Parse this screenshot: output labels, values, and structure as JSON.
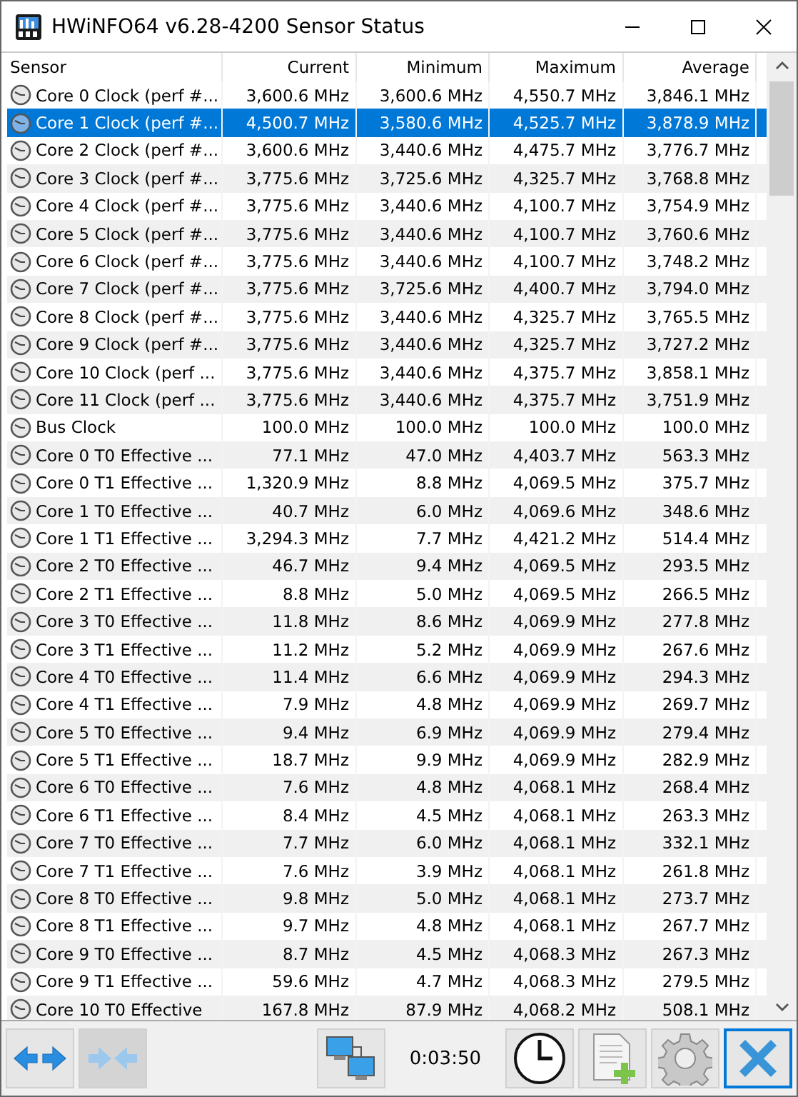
{
  "window": {
    "title": "HWiNFO64 v6.28-4200 Sensor Status"
  },
  "table": {
    "columns": [
      "Sensor",
      "Current",
      "Minimum",
      "Maximum",
      "Average"
    ],
    "rows": [
      {
        "sensor": "Core 0 Clock (perf #...",
        "current": "3,600.6 MHz",
        "minimum": "3,600.6 MHz",
        "maximum": "4,550.7 MHz",
        "average": "3,846.1 MHz",
        "selected": false
      },
      {
        "sensor": "Core 1 Clock (perf #...",
        "current": "4,500.7 MHz",
        "minimum": "3,580.6 MHz",
        "maximum": "4,525.7 MHz",
        "average": "3,878.9 MHz",
        "selected": true
      },
      {
        "sensor": "Core 2 Clock (perf #...",
        "current": "3,600.6 MHz",
        "minimum": "3,440.6 MHz",
        "maximum": "4,475.7 MHz",
        "average": "3,776.7 MHz",
        "selected": false
      },
      {
        "sensor": "Core 3 Clock (perf #...",
        "current": "3,775.6 MHz",
        "minimum": "3,725.6 MHz",
        "maximum": "4,325.7 MHz",
        "average": "3,768.8 MHz",
        "selected": false
      },
      {
        "sensor": "Core 4 Clock (perf #...",
        "current": "3,775.6 MHz",
        "minimum": "3,440.6 MHz",
        "maximum": "4,100.7 MHz",
        "average": "3,754.9 MHz",
        "selected": false
      },
      {
        "sensor": "Core 5 Clock (perf #...",
        "current": "3,775.6 MHz",
        "minimum": "3,440.6 MHz",
        "maximum": "4,100.7 MHz",
        "average": "3,760.6 MHz",
        "selected": false
      },
      {
        "sensor": "Core 6 Clock (perf #...",
        "current": "3,775.6 MHz",
        "minimum": "3,440.6 MHz",
        "maximum": "4,100.7 MHz",
        "average": "3,748.2 MHz",
        "selected": false
      },
      {
        "sensor": "Core 7 Clock (perf #...",
        "current": "3,775.6 MHz",
        "minimum": "3,725.6 MHz",
        "maximum": "4,400.7 MHz",
        "average": "3,794.0 MHz",
        "selected": false
      },
      {
        "sensor": "Core 8 Clock (perf #...",
        "current": "3,775.6 MHz",
        "minimum": "3,440.6 MHz",
        "maximum": "4,325.7 MHz",
        "average": "3,765.5 MHz",
        "selected": false
      },
      {
        "sensor": "Core 9 Clock (perf #...",
        "current": "3,775.6 MHz",
        "minimum": "3,440.6 MHz",
        "maximum": "4,325.7 MHz",
        "average": "3,727.2 MHz",
        "selected": false
      },
      {
        "sensor": "Core 10 Clock (perf ...",
        "current": "3,775.6 MHz",
        "minimum": "3,440.6 MHz",
        "maximum": "4,375.7 MHz",
        "average": "3,858.1 MHz",
        "selected": false
      },
      {
        "sensor": "Core 11 Clock (perf ...",
        "current": "3,775.6 MHz",
        "minimum": "3,440.6 MHz",
        "maximum": "4,375.7 MHz",
        "average": "3,751.9 MHz",
        "selected": false
      },
      {
        "sensor": "Bus Clock",
        "current": "100.0 MHz",
        "minimum": "100.0 MHz",
        "maximum": "100.0 MHz",
        "average": "100.0 MHz",
        "selected": false
      },
      {
        "sensor": "Core 0 T0 Effective ...",
        "current": "77.1 MHz",
        "minimum": "47.0 MHz",
        "maximum": "4,403.7 MHz",
        "average": "563.3 MHz",
        "selected": false
      },
      {
        "sensor": "Core 0 T1 Effective ...",
        "current": "1,320.9 MHz",
        "minimum": "8.8 MHz",
        "maximum": "4,069.5 MHz",
        "average": "375.7 MHz",
        "selected": false
      },
      {
        "sensor": "Core 1 T0 Effective ...",
        "current": "40.7 MHz",
        "minimum": "6.0 MHz",
        "maximum": "4,069.6 MHz",
        "average": "348.6 MHz",
        "selected": false
      },
      {
        "sensor": "Core 1 T1 Effective ...",
        "current": "3,294.3 MHz",
        "minimum": "7.7 MHz",
        "maximum": "4,421.2 MHz",
        "average": "514.4 MHz",
        "selected": false
      },
      {
        "sensor": "Core 2 T0 Effective ...",
        "current": "46.7 MHz",
        "minimum": "9.4 MHz",
        "maximum": "4,069.5 MHz",
        "average": "293.5 MHz",
        "selected": false
      },
      {
        "sensor": "Core 2 T1 Effective ...",
        "current": "8.8 MHz",
        "minimum": "5.0 MHz",
        "maximum": "4,069.5 MHz",
        "average": "266.5 MHz",
        "selected": false
      },
      {
        "sensor": "Core 3 T0 Effective ...",
        "current": "11.8 MHz",
        "minimum": "8.6 MHz",
        "maximum": "4,069.9 MHz",
        "average": "277.8 MHz",
        "selected": false
      },
      {
        "sensor": "Core 3 T1 Effective ...",
        "current": "11.2 MHz",
        "minimum": "5.2 MHz",
        "maximum": "4,069.9 MHz",
        "average": "267.6 MHz",
        "selected": false
      },
      {
        "sensor": "Core 4 T0 Effective ...",
        "current": "11.4 MHz",
        "minimum": "6.6 MHz",
        "maximum": "4,069.9 MHz",
        "average": "294.3 MHz",
        "selected": false
      },
      {
        "sensor": "Core 4 T1 Effective ...",
        "current": "7.9 MHz",
        "minimum": "4.8 MHz",
        "maximum": "4,069.9 MHz",
        "average": "269.7 MHz",
        "selected": false
      },
      {
        "sensor": "Core 5 T0 Effective ...",
        "current": "9.4 MHz",
        "minimum": "6.9 MHz",
        "maximum": "4,069.9 MHz",
        "average": "279.4 MHz",
        "selected": false
      },
      {
        "sensor": "Core 5 T1 Effective ...",
        "current": "18.7 MHz",
        "minimum": "9.9 MHz",
        "maximum": "4,069.9 MHz",
        "average": "282.9 MHz",
        "selected": false
      },
      {
        "sensor": "Core 6 T0 Effective ...",
        "current": "7.6 MHz",
        "minimum": "4.8 MHz",
        "maximum": "4,068.1 MHz",
        "average": "268.4 MHz",
        "selected": false
      },
      {
        "sensor": "Core 6 T1 Effective ...",
        "current": "8.4 MHz",
        "minimum": "4.5 MHz",
        "maximum": "4,068.1 MHz",
        "average": "263.3 MHz",
        "selected": false
      },
      {
        "sensor": "Core 7 T0 Effective ...",
        "current": "7.7 MHz",
        "minimum": "6.0 MHz",
        "maximum": "4,068.1 MHz",
        "average": "332.1 MHz",
        "selected": false
      },
      {
        "sensor": "Core 7 T1 Effective ...",
        "current": "7.6 MHz",
        "minimum": "3.9 MHz",
        "maximum": "4,068.1 MHz",
        "average": "261.8 MHz",
        "selected": false
      },
      {
        "sensor": "Core 8 T0 Effective ...",
        "current": "9.8 MHz",
        "minimum": "5.0 MHz",
        "maximum": "4,068.1 MHz",
        "average": "273.7 MHz",
        "selected": false
      },
      {
        "sensor": "Core 8 T1 Effective ...",
        "current": "9.7 MHz",
        "minimum": "4.8 MHz",
        "maximum": "4,068.1 MHz",
        "average": "267.7 MHz",
        "selected": false
      },
      {
        "sensor": "Core 9 T0 Effective ...",
        "current": "8.7 MHz",
        "minimum": "4.5 MHz",
        "maximum": "4,068.3 MHz",
        "average": "267.3 MHz",
        "selected": false
      },
      {
        "sensor": "Core 9 T1 Effective ...",
        "current": "59.6 MHz",
        "minimum": "4.7 MHz",
        "maximum": "4,068.3 MHz",
        "average": "279.5 MHz",
        "selected": false
      },
      {
        "sensor": "Core 10 T0 Effective",
        "current": "167.8 MHz",
        "minimum": "87.9 MHz",
        "maximum": "4,068.2 MHz",
        "average": "508.1 MHz",
        "selected": false
      }
    ]
  },
  "toolbar": {
    "timer": "0:03:50",
    "buttons": [
      {
        "kind": "expand",
        "disabled": false
      },
      {
        "kind": "collapse",
        "disabled": true
      },
      {
        "kind": "network",
        "disabled": false
      },
      {
        "kind": "clock",
        "disabled": false
      },
      {
        "kind": "report",
        "disabled": false
      },
      {
        "kind": "settings",
        "disabled": false
      },
      {
        "kind": "close",
        "disabled": false
      }
    ]
  }
}
